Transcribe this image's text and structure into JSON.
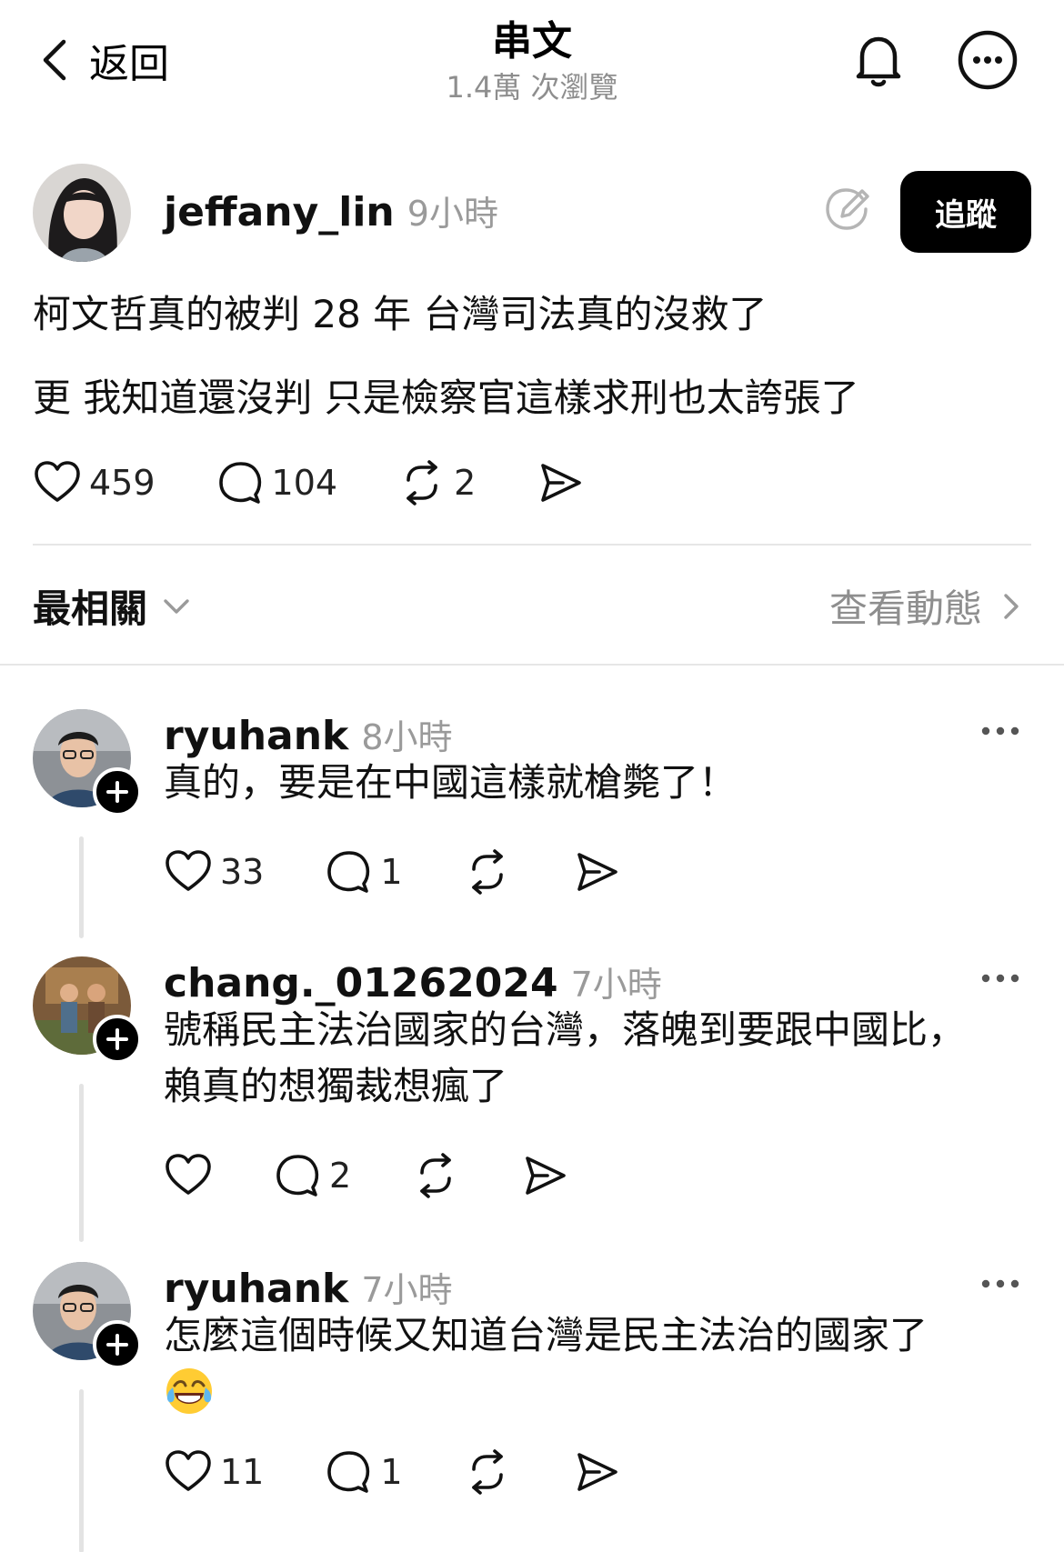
{
  "header": {
    "back_label": "返回",
    "title": "串文",
    "views": "1.4萬 次瀏覽"
  },
  "post": {
    "username": "jeffany_lin",
    "time": "9小時",
    "follow_label": "追蹤",
    "lines": [
      "柯文哲真的被判 28 年 台灣司法真的沒救了",
      "更 我知道還沒判 只是檢察官這樣求刑也太誇張了"
    ],
    "likes": "459",
    "comments": "104",
    "reposts": "2"
  },
  "sort": {
    "label": "最相關",
    "activity_label": "查看動態"
  },
  "replies": [
    {
      "username": "ryuhank",
      "time": "8小時",
      "lines": [
        "真的，要是在中國這樣就槍斃了！"
      ],
      "likes": "33",
      "comments": "1",
      "reposts": ""
    },
    {
      "username": "chang._01262024",
      "time": "7小時",
      "lines": [
        "號稱民主法治國家的台灣，落魄到要跟中國比，",
        "賴真的想獨裁想瘋了"
      ],
      "likes": "",
      "comments": "2",
      "reposts": ""
    },
    {
      "username": "ryuhank",
      "time": "7小時",
      "lines": [
        "怎麼這個時候又知道台灣是民主法治的國家了"
      ],
      "emoji": "tears-of-joy-emoji",
      "likes": "11",
      "comments": "1",
      "reposts": ""
    }
  ],
  "icons": {
    "back": "chevron-left-icon",
    "bell": "bell-icon",
    "more": "more-circle-icon",
    "edit": "pencil-circle-icon",
    "like": "heart-icon",
    "comment": "comment-icon",
    "repost": "repost-icon",
    "share": "send-icon"
  },
  "colors": {
    "text": "#111111",
    "muted": "#8e8e8e",
    "follow_bg": "#000000",
    "divider": "#e6e6e6"
  }
}
